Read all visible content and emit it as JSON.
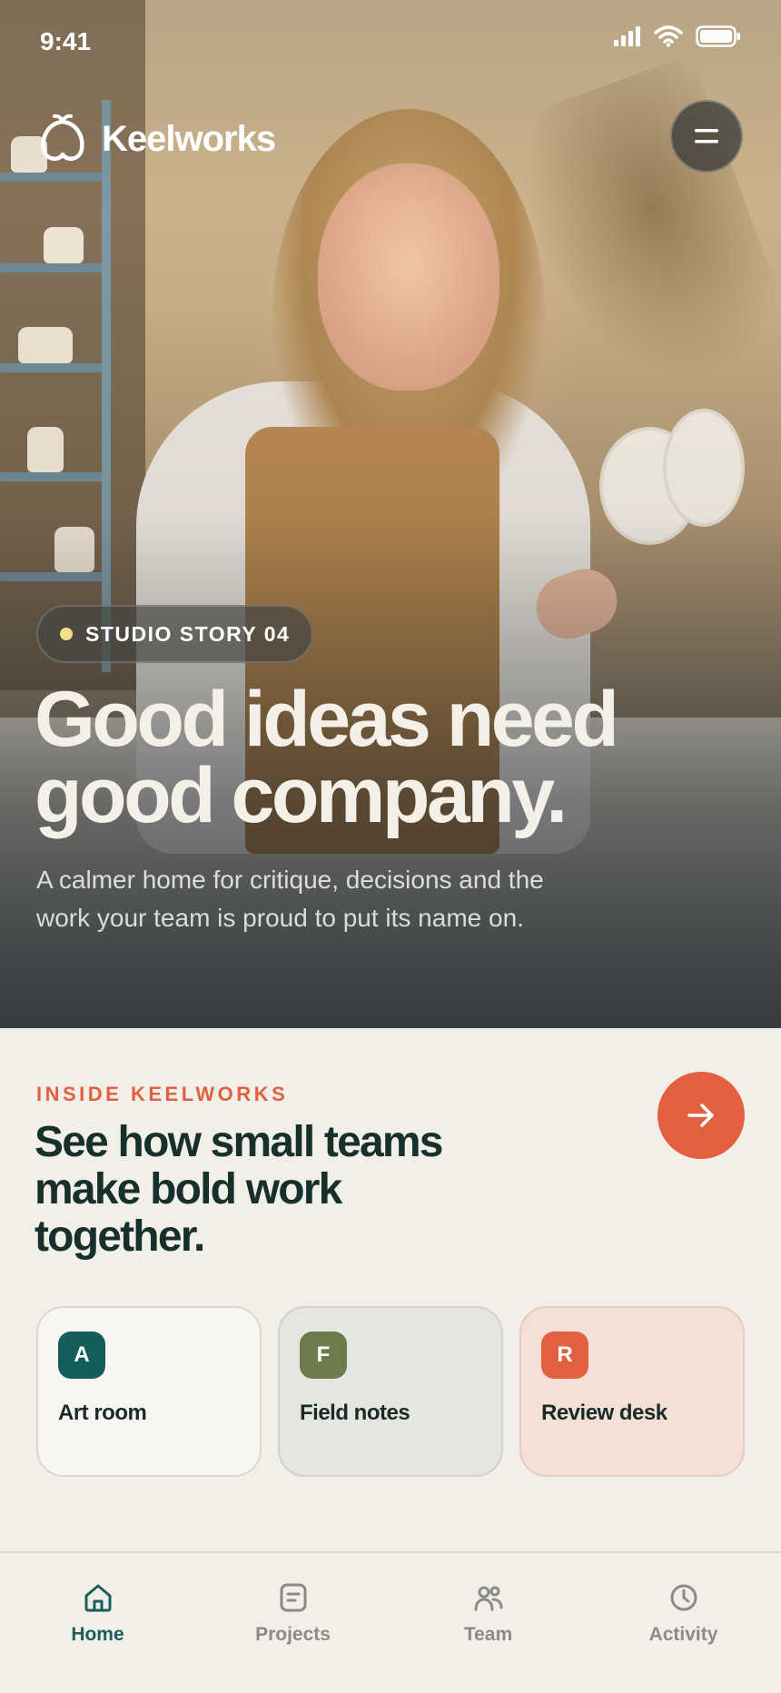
{
  "status_bar": {
    "time": "9:41"
  },
  "header": {
    "brand_name": "Keelworks",
    "brand_icon": "leaf-logo-icon",
    "menu_icon": "menu-icon"
  },
  "hero": {
    "tag": "STUDIO STORY 04",
    "headline": "Good ideas need good company.",
    "subcopy": "A calmer home for critique, decisions and the work your team is proud to put its name on."
  },
  "section": {
    "eyebrow": "INSIDE KEELWORKS",
    "title": "See how small teams make bold work together.",
    "arrow_icon": "arrow-right-icon"
  },
  "cards": [
    {
      "letter": "A",
      "title": "Art room",
      "color": "#135e5a",
      "bg": "#f8f6f0"
    },
    {
      "letter": "F",
      "title": "Field notes",
      "color": "#6e7b4a",
      "bg": "#e4e7e0"
    },
    {
      "letter": "R",
      "title": "Review desk",
      "color": "#e2603f",
      "bg": "#f4e0d6"
    }
  ],
  "tabbar": {
    "items": [
      {
        "label": "Home",
        "icon": "home-icon",
        "active": true
      },
      {
        "label": "Projects",
        "icon": "document-icon",
        "active": false
      },
      {
        "label": "Team",
        "icon": "people-icon",
        "active": false
      },
      {
        "label": "Activity",
        "icon": "clock-icon",
        "active": false
      }
    ]
  },
  "colors": {
    "accent": "#e2603f",
    "brand_teal": "#1b5c5c",
    "background": "#f2efe9"
  }
}
